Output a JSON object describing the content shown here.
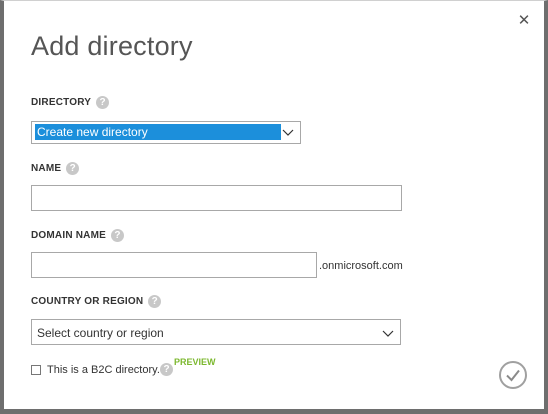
{
  "dialog": {
    "title": "Add directory",
    "close_icon": "close-icon",
    "confirm_icon": "checkmark-icon"
  },
  "directory": {
    "label": "DIRECTORY",
    "selected": "Create new directory"
  },
  "name": {
    "label": "NAME",
    "value": ""
  },
  "domain": {
    "label": "DOMAIN NAME",
    "value": "",
    "suffix": ".onmicrosoft.com"
  },
  "country": {
    "label": "COUNTRY OR REGION",
    "selected": "Select country or region"
  },
  "b2c": {
    "label": "This is a B2C directory.",
    "badge": "PREVIEW",
    "checked": false
  },
  "colors": {
    "accent": "#1c8fdb",
    "preview": "#7cb82f",
    "border": "#6e6e6e"
  }
}
